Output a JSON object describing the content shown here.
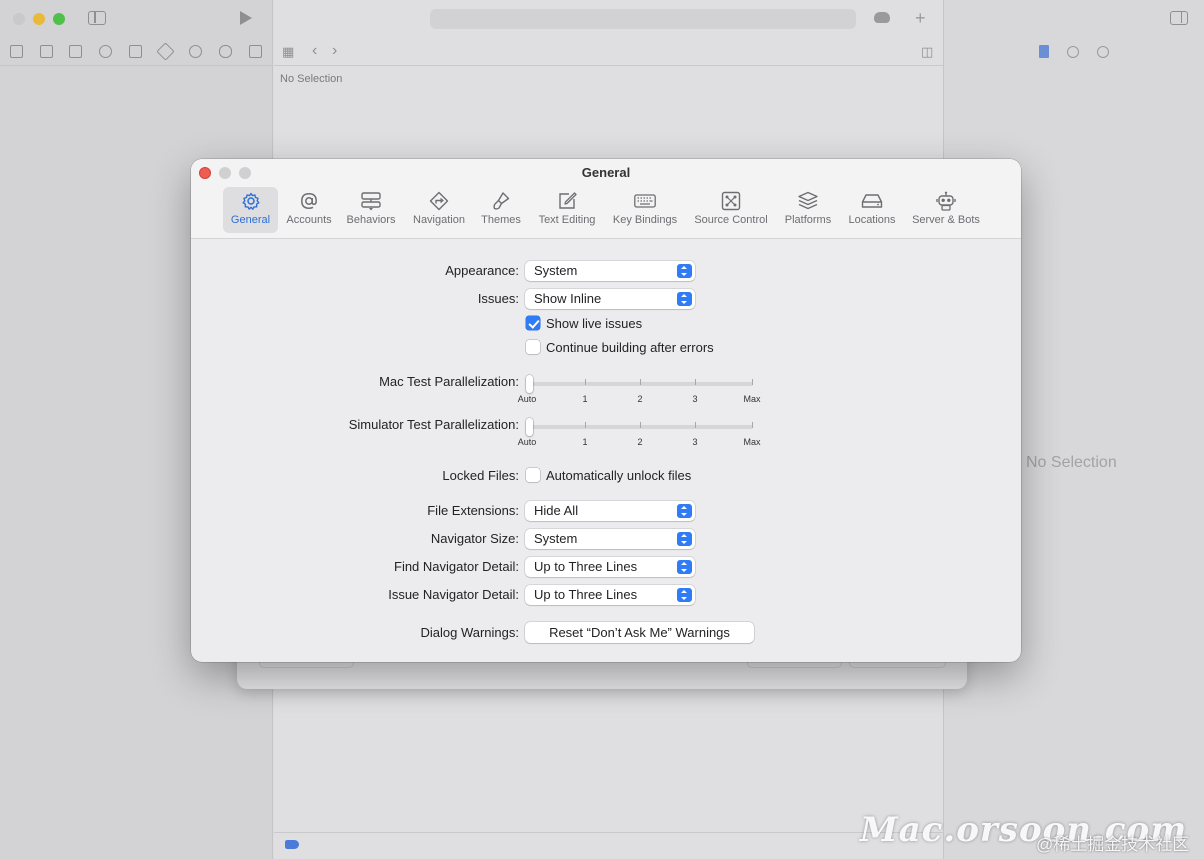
{
  "background": {
    "editor_empty_text": "No Selection",
    "inspector_empty_text": "No Selection"
  },
  "prefs": {
    "title": "General",
    "active_tab": "General",
    "accent_color": "#2f7cf6",
    "tabs": [
      {
        "label": "General",
        "icon": "gear-icon"
      },
      {
        "label": "Accounts",
        "icon": "at-sign-icon"
      },
      {
        "label": "Behaviors",
        "icon": "behaviors-icon"
      },
      {
        "label": "Navigation",
        "icon": "navigation-icon"
      },
      {
        "label": "Themes",
        "icon": "brush-icon"
      },
      {
        "label": "Text Editing",
        "icon": "pencil-square-icon"
      },
      {
        "label": "Key Bindings",
        "icon": "keyboard-icon"
      },
      {
        "label": "Source Control",
        "icon": "source-control-icon"
      },
      {
        "label": "Platforms",
        "icon": "layers-icon"
      },
      {
        "label": "Locations",
        "icon": "drive-icon"
      },
      {
        "label": "Server & Bots",
        "icon": "robot-icon"
      }
    ],
    "appearance": {
      "label": "Appearance:",
      "value": "System"
    },
    "issues": {
      "label": "Issues:",
      "value": "Show Inline"
    },
    "show_live_issues": {
      "label": "Show live issues",
      "checked": true
    },
    "continue_building": {
      "label": "Continue building after errors",
      "checked": false
    },
    "mac_parallel": {
      "label": "Mac Test Parallelization:",
      "ticks": [
        "Auto",
        "1",
        "2",
        "3",
        "Max"
      ],
      "value": "Auto"
    },
    "sim_parallel": {
      "label": "Simulator Test Parallelization:",
      "ticks": [
        "Auto",
        "1",
        "2",
        "3",
        "Max"
      ],
      "value": "Auto"
    },
    "locked_files": {
      "label": "Locked Files:",
      "checkbox_label": "Automatically unlock files",
      "checked": false
    },
    "file_extensions": {
      "label": "File Extensions:",
      "value": "Hide All"
    },
    "navigator_size": {
      "label": "Navigator Size:",
      "value": "System"
    },
    "find_nav_detail": {
      "label": "Find Navigator Detail:",
      "value": "Up to Three Lines"
    },
    "issue_nav_detail": {
      "label": "Issue Navigator Detail:",
      "value": "Up to Three Lines"
    },
    "dialog_warnings": {
      "label": "Dialog Warnings:",
      "button": "Reset “Don’t Ask Me” Warnings"
    }
  },
  "watermark": {
    "site": "Mac.orsoon.com",
    "community": "@稀土掘金技术社区"
  }
}
